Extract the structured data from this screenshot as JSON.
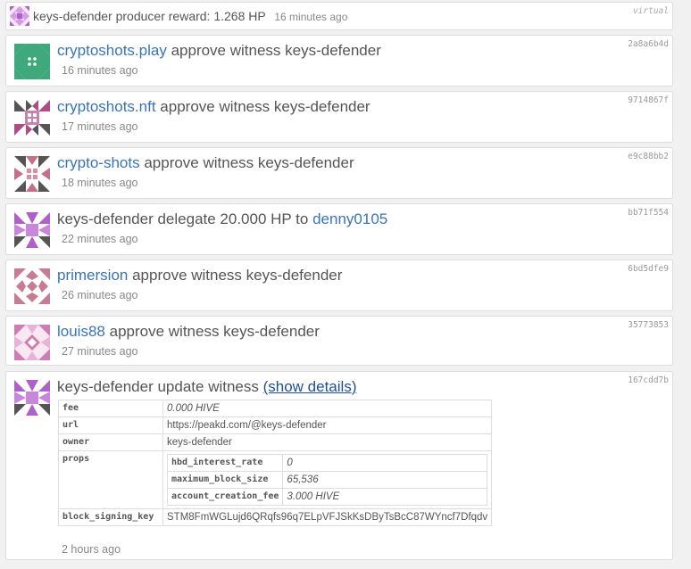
{
  "ops": [
    {
      "kind": "virtual",
      "account": "keys-defender",
      "text": "producer reward: 1.268 HP",
      "time": "16 minutes ago",
      "tx": "virtual",
      "colors": {
        "fg": "#b061c9",
        "bg": "#f4e8f7"
      }
    },
    {
      "account": "cryptoshots.play",
      "text": "approve witness keys-defender",
      "time": "16 minutes ago",
      "tx": "2a8a6b4d",
      "colors": {
        "fg": "#3fa97c",
        "bg": "#e2f4ea"
      }
    },
    {
      "account": "cryptoshots.nft",
      "text": "approve witness keys-defender",
      "time": "17 minutes ago",
      "tx": "9714867f",
      "colors": {
        "fg": "#b14a86",
        "bg": "#f2e1ec"
      }
    },
    {
      "account": "crypto-shots",
      "text": "approve witness keys-defender",
      "time": "18 minutes ago",
      "tx": "e9c88bb2",
      "colors": {
        "fg": "#c66f86",
        "bg": "#f6e4ea"
      }
    },
    {
      "account": "keys-defender",
      "text_prefix": "delegate 20.000 HP to",
      "target": "denny0105",
      "time": "22 minutes ago",
      "tx": "bb71f554",
      "colors": {
        "fg": "#b061c9",
        "bg": "#f4e8f7"
      }
    },
    {
      "account": "primersion",
      "text": "approve witness keys-defender",
      "time": "26 minutes ago",
      "tx": "6bd5dfe9",
      "colors": {
        "fg": "#c77c93",
        "bg": "#f7e6ec"
      }
    },
    {
      "account": "louis88",
      "text": "approve witness keys-defender",
      "time": "27 minutes ago",
      "tx": "35773853",
      "colors": {
        "fg": "#d07db4",
        "bg": "#f9e7f2"
      }
    },
    {
      "account": "keys-defender",
      "text": "update witness",
      "details_link": "(show details)",
      "time": "2 hours ago",
      "tx": "167cdd7b",
      "colors": {
        "fg": "#b061c9",
        "bg": "#f4e8f7"
      },
      "details": {
        "fee": {
          "key": "fee",
          "value": "0.000 HIVE"
        },
        "url": {
          "key": "url",
          "value": "https://peakd.com/@keys-defender"
        },
        "owner": {
          "key": "owner",
          "value": "keys-defender"
        },
        "props": {
          "key": "props",
          "hbd_interest_rate": {
            "key": "hbd_interest_rate",
            "value": "0"
          },
          "maximum_block_size": {
            "key": "maximum_block_size",
            "value": "65,536"
          },
          "account_creation_fee": {
            "key": "account_creation_fee",
            "value": "3.000 HIVE"
          }
        },
        "block_signing_key": {
          "key": "block_signing_key",
          "value": "STM8FmWGLujd6QRqfs96q7ELpVFJSkKsDByTsBcC87WYncf7Dfqdv"
        }
      }
    }
  ]
}
